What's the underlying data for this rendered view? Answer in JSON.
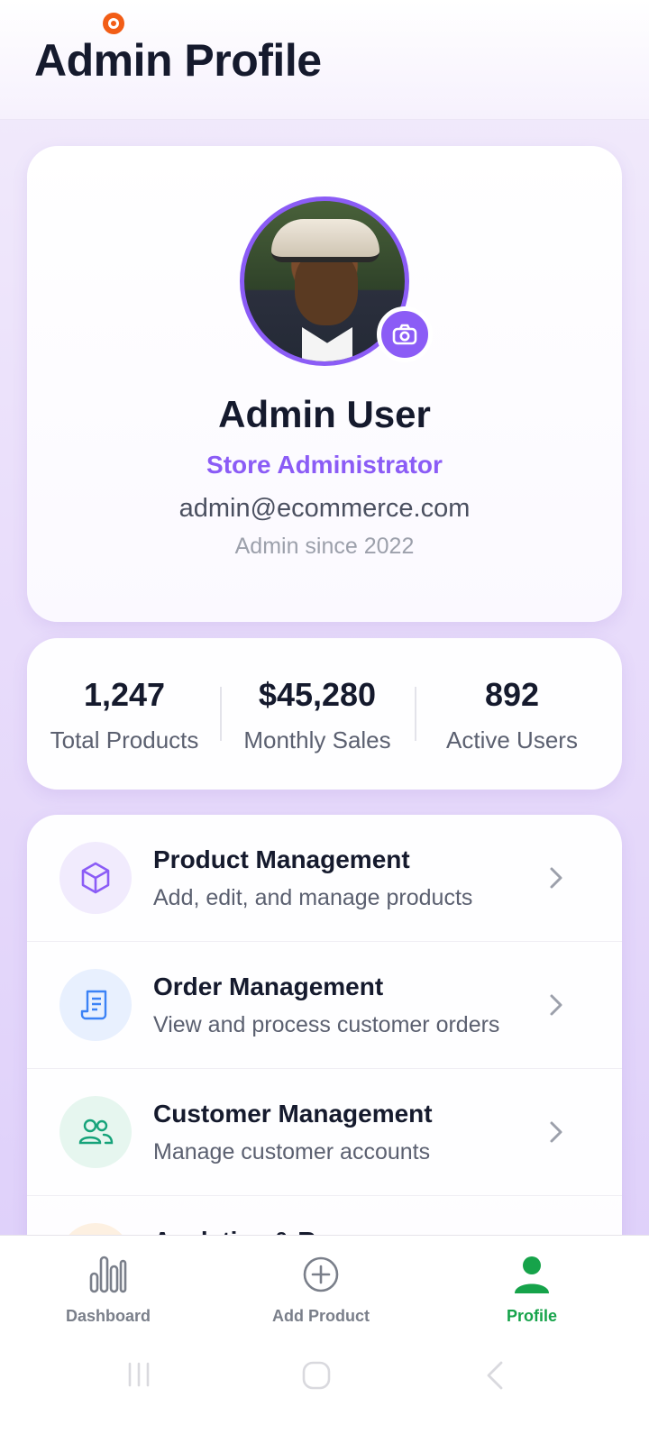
{
  "header": {
    "title": "Admin Profile"
  },
  "profile": {
    "name": "Admin User",
    "role": "Store Administrator",
    "email": "admin@ecommerce.com",
    "since": "Admin since 2022"
  },
  "stats": [
    {
      "value": "1,247",
      "label": "Total Products"
    },
    {
      "value": "$45,280",
      "label": "Monthly Sales"
    },
    {
      "value": "892",
      "label": "Active Users"
    }
  ],
  "menu": [
    {
      "title": "Product Management",
      "subtitle": "Add, edit, and manage products",
      "icon": "cube-icon"
    },
    {
      "title": "Order Management",
      "subtitle": "View and process customer orders",
      "icon": "receipt-icon"
    },
    {
      "title": "Customer Management",
      "subtitle": "Manage customer accounts",
      "icon": "users-icon"
    },
    {
      "title": "Analytics & R…",
      "subtitle": "",
      "icon": "chart-icon"
    }
  ],
  "bottom_nav": [
    {
      "label": "Dashboard",
      "icon": "bar-chart-icon",
      "active": false
    },
    {
      "label": "Add Product",
      "icon": "plus-circle-icon",
      "active": false
    },
    {
      "label": "Profile",
      "icon": "person-icon",
      "active": true
    }
  ],
  "colors": {
    "accent": "#8b5cf6",
    "active_nav": "#16a34a",
    "text": "#151a2d"
  }
}
